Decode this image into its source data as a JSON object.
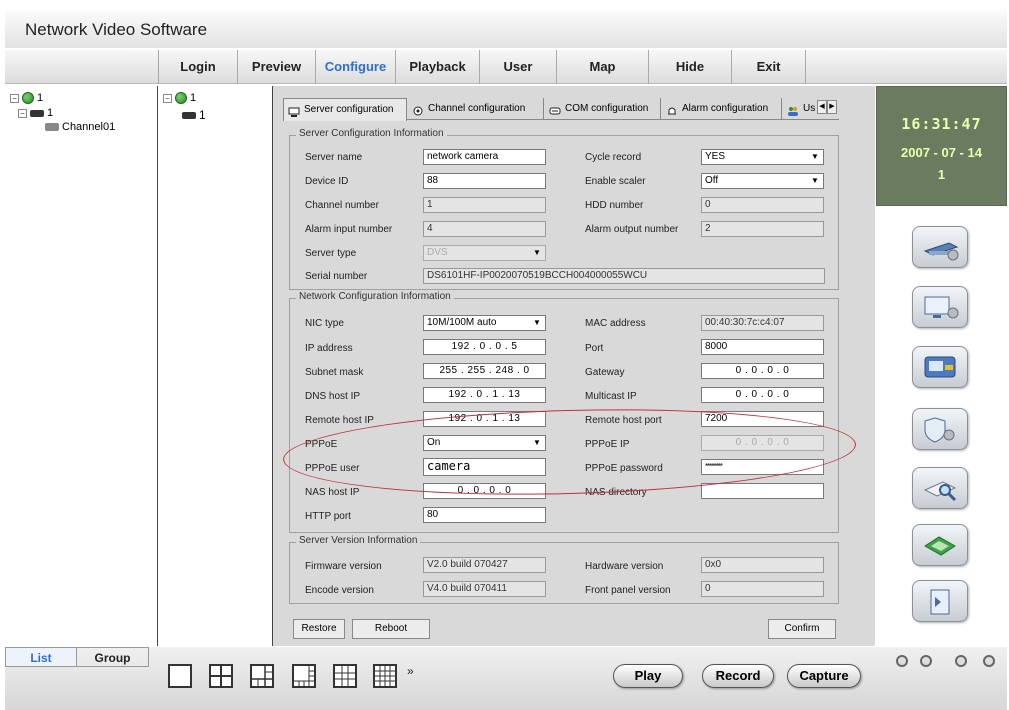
{
  "app": {
    "title": "Network Video Software"
  },
  "menu": {
    "items": [
      "Login",
      "Preview",
      "Configure",
      "Playback",
      "User",
      "Map",
      "Hide",
      "Exit"
    ],
    "active": "Configure"
  },
  "tree_left": {
    "root": "1",
    "device": "1",
    "channel": "Channel01"
  },
  "tree_mid": {
    "root": "1",
    "device": "1"
  },
  "tabs": [
    "Server configuration",
    "Channel configuration",
    "COM configuration",
    "Alarm configuration",
    "Us"
  ],
  "server_info": {
    "title": "Server Configuration Information",
    "server_name_label": "Server name",
    "server_name": "network camera",
    "device_id_label": "Device ID",
    "device_id": "88",
    "channel_number_label": "Channel number",
    "channel_number": "1",
    "alarm_input_label": "Alarm input number",
    "alarm_input": "4",
    "server_type_label": "Server type",
    "server_type": "DVS",
    "serial_number_label": "Serial number",
    "serial_number": "DS6101HF-IP0020070519BCCH004000055WCU",
    "cycle_record_label": "Cycle record",
    "cycle_record": "YES",
    "enable_scaler_label": "Enable scaler",
    "enable_scaler": "Off",
    "hdd_number_label": "HDD number",
    "hdd_number": "0",
    "alarm_output_label": "Alarm output number",
    "alarm_output": "2"
  },
  "network_info": {
    "title": "Network Configuration Information",
    "nic_type_label": "NIC type",
    "nic_type": "10M/100M auto",
    "ip_label": "IP address",
    "ip": "192 .  0  .  0  .  5",
    "subnet_label": "Subnet mask",
    "subnet": "255 . 255 . 248 .  0",
    "dns_label": "DNS host IP",
    "dns": "192 .  0  .  1  . 13",
    "remote_label": "Remote host IP",
    "remote": "192 .  0  .  1  . 13",
    "pppoe_label": "PPPoE",
    "pppoe": "On",
    "pppoe_user_label": "PPPoE user",
    "pppoe_user": "camera",
    "nas_ip_label": "NAS host IP",
    "nas_ip": "0  .  0  .  0  .  0",
    "http_port_label": "HTTP port",
    "http_port": "80",
    "mac_label": "MAC address",
    "mac": "00:40:30:7c:c4:07",
    "port_label": "Port",
    "port": "8000",
    "gateway_label": "Gateway",
    "gateway": "0  .  0  .  0  .  0",
    "multicast_label": "Multicast IP",
    "multicast": "0  .  0  .  0  .  0",
    "remote_port_label": "Remote host port",
    "remote_port": "7200",
    "pppoe_ip_label": "PPPoE IP",
    "pppoe_ip": "0  .  0  .  0  .  0",
    "pppoe_password_label": "PPPoE password",
    "pppoe_password": "********",
    "nas_dir_label": "NAS directory",
    "nas_dir": ""
  },
  "version_info": {
    "title": "Server Version Information",
    "firmware_label": "Firmware version",
    "firmware": "V2.0 build 070427",
    "encode_label": "Encode version",
    "encode": "V4.0 build 070411",
    "hardware_label": "Hardware version",
    "hardware": "0x0",
    "front_panel_label": "Front panel version",
    "front_panel": "0"
  },
  "buttons": {
    "restore": "Restore",
    "reboot": "Reboot",
    "confirm": "Confirm"
  },
  "clock": {
    "time": "16:31:47",
    "date": "2007 - 07 - 14",
    "day": "1"
  },
  "bottom": {
    "list_tab": "List",
    "group_tab": "Group",
    "more": "»",
    "play": "Play",
    "record": "Record",
    "capture": "Capture"
  },
  "colors": {
    "accent": "#2b6fd8",
    "clock_bg": "#6b7b5f",
    "clock_text": "#e8ffb0",
    "highlight": "#c0303a"
  }
}
